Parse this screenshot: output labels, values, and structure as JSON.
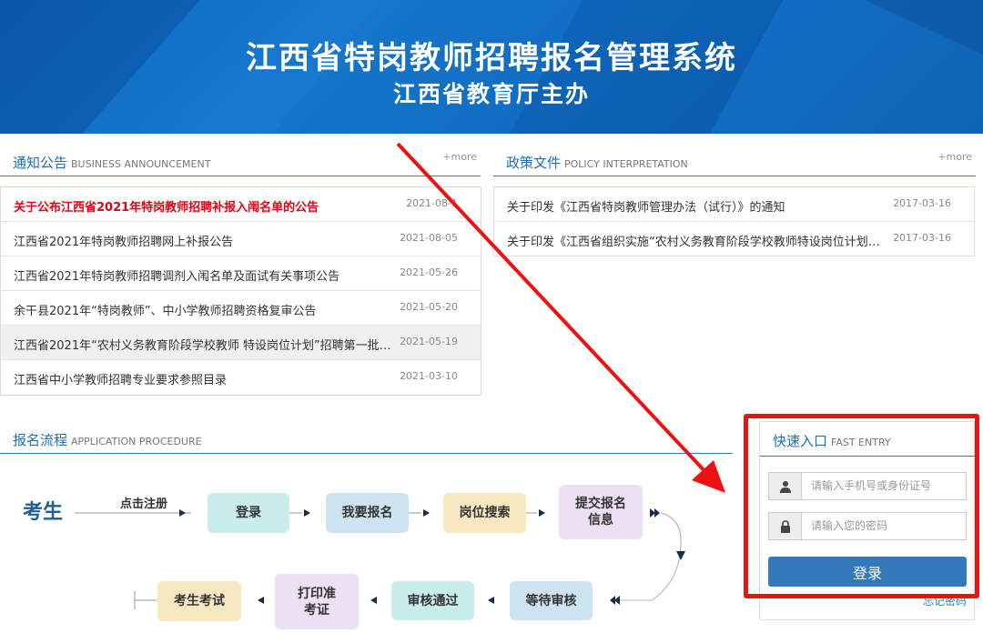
{
  "header": {
    "title": "江西省特岗教师招聘报名管理系统",
    "subtitle": "江西省教育厅主办"
  },
  "announcements": {
    "title_zh": "通知公告",
    "title_en": "BUSINESS ANNOUNCEMENT",
    "more": "+more",
    "items": [
      {
        "title": "关于公布江西省2021年特岗教师招聘补报入闱名单的公告",
        "date": "2021-08-1"
      },
      {
        "title": "江西省2021年特岗教师招聘网上补报公告",
        "date": "2021-08-05"
      },
      {
        "title": "江西省2021年特岗教师招聘调剂入闱名单及面试有关事项公告",
        "date": "2021-05-26"
      },
      {
        "title": "余干县2021年“特岗教师”、中小学教师招聘资格复审公告",
        "date": "2021-05-20"
      },
      {
        "title": "江西省2021年“农村义务教育阶段学校教师 特设岗位计划”招聘第一批…",
        "date": "2021-05-19"
      },
      {
        "title": "江西省中小学教师招聘专业要求参照目录",
        "date": "2021-03-10"
      }
    ]
  },
  "policy": {
    "title_zh": "政策文件",
    "title_en": "POLICY INTERPRETATION",
    "more": "+more",
    "items": [
      {
        "title": "关于印发《江西省特岗教师管理办法（试行）》的通知",
        "date": "2017-03-16"
      },
      {
        "title": "关于印发《江西省组织实施“农村义务教育阶段学校教师特设岗位计划”…",
        "date": "2017-03-16"
      }
    ]
  },
  "procedure": {
    "title_zh": "报名流程",
    "title_en": "APPLICATION PROCEDURE",
    "start_label": "考生",
    "register_label": "点击注册",
    "steps": {
      "login": "登录",
      "apply": "我要报名",
      "search": "岗位搜索",
      "submit": "提交报名信息",
      "wait": "等待审核",
      "pass": "审核通过",
      "print": "打印准考证",
      "exam": "考生考试"
    }
  },
  "fast_entry": {
    "title_zh": "快速入口",
    "title_en": "FAST ENTRY",
    "username_placeholder": "请输入手机号或身份证号",
    "password_placeholder": "请输入您的密码",
    "login_label": "登录",
    "forgot_label": "忘记密码"
  },
  "colors": {
    "header_blue": "#1677cc",
    "accent_blue": "#1e6fb8",
    "button_blue": "#3479b9",
    "highlight_red": "#e60012",
    "annotation_red": "#ee1111"
  }
}
